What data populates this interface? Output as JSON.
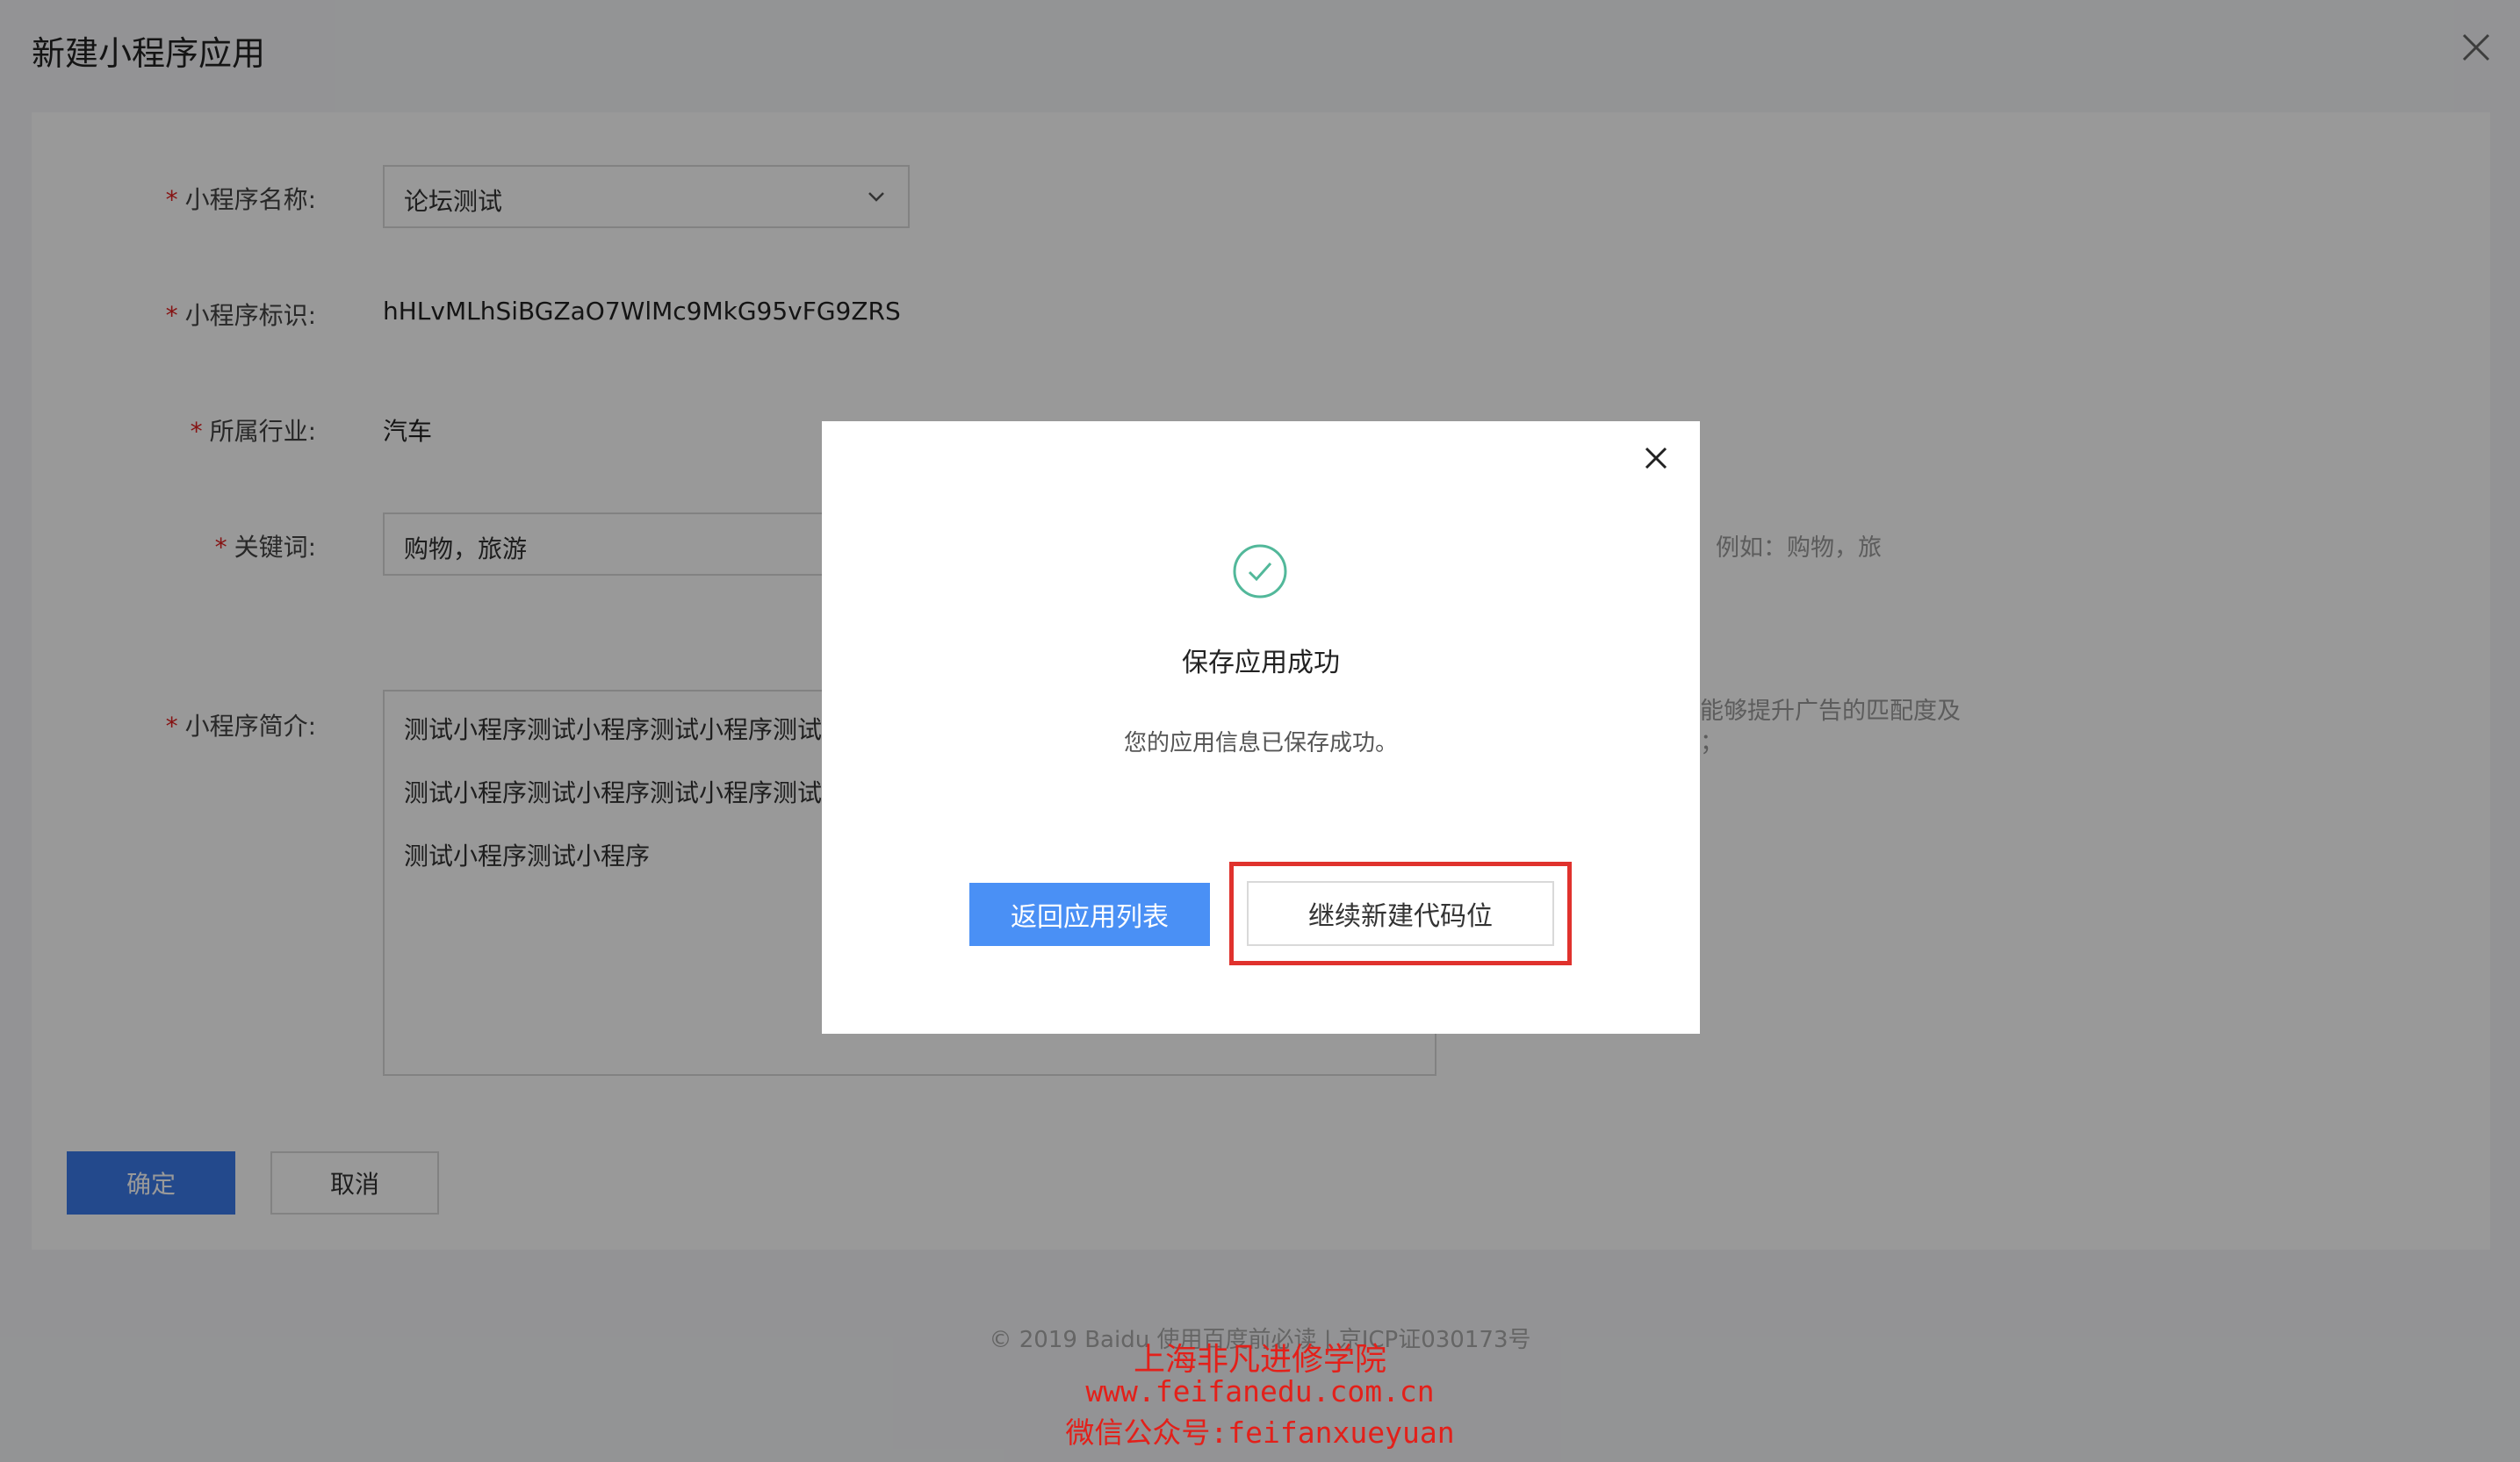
{
  "page": {
    "title": "新建小程序应用"
  },
  "form": {
    "name": {
      "label": "小程序名称:",
      "value": "论坛测试"
    },
    "identifier": {
      "label": "小程序标识:",
      "value": "hHLvMLhSiBGZaO7WlMc9MkG95vFG9ZRS"
    },
    "industry": {
      "label": "所属行业:",
      "value": "汽车"
    },
    "keywords": {
      "label": "关键词:",
      "value": "购物，旅游",
      "hint": "号，例如：购物，旅"
    },
    "intro": {
      "label": "小程序简介:",
      "lines": [
        "测试小程序测试小程序测试小程序测试",
        "测试小程序测试小程序测试小程序测试",
        "测试小程序测试小程序"
      ],
      "hint_line1": "能够提升广告的匹配度及",
      "hint_line2": "；"
    },
    "required_mark": "*"
  },
  "actions": {
    "confirm": "确定",
    "cancel": "取消"
  },
  "footer": {
    "text": "©  2019 Baidu  使用百度前必读 | 京ICP证030173号"
  },
  "modal": {
    "title": "保存应用成功",
    "message": "您的应用信息已保存成功。",
    "primary_button": "返回应用列表",
    "secondary_button": "继续新建代码位"
  },
  "watermark": {
    "line1": "上海非凡进修学院",
    "line2": "www.feifanedu.com.cn",
    "line3": "微信公众号:feifanxueyuan"
  },
  "colors": {
    "primary": "#3b7bea",
    "modal_primary": "#4a90f5",
    "success": "#52b89a",
    "highlight": "#e0322d",
    "watermark": "#e3201a"
  },
  "icons": {
    "page_close": "close-icon",
    "select_arrow": "chevron-down-icon",
    "modal_close": "close-icon",
    "success": "check-circle-icon"
  }
}
